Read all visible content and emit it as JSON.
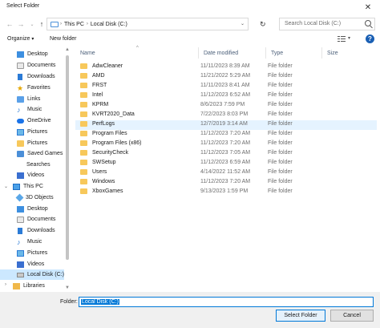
{
  "window": {
    "title": "Select Folder"
  },
  "address": {
    "crumbs": [
      "This PC",
      "Local Disk (C:)"
    ]
  },
  "search": {
    "placeholder": "Search Local Disk (C:)"
  },
  "toolbar": {
    "organize": "Organize",
    "new_folder": "New folder",
    "help": "?"
  },
  "nav": {
    "items": [
      {
        "label": "Desktop",
        "icon": "desktop-icon"
      },
      {
        "label": "Documents",
        "icon": "documents-icon"
      },
      {
        "label": "Downloads",
        "icon": "downloads-icon"
      },
      {
        "label": "Favorites",
        "icon": "favorites-icon"
      },
      {
        "label": "Links",
        "icon": "links-icon"
      },
      {
        "label": "Music",
        "icon": "music-icon"
      },
      {
        "label": "OneDrive",
        "icon": "onedrive-icon"
      },
      {
        "label": "Pictures",
        "icon": "pictures-icon"
      },
      {
        "label": "Pictures",
        "icon": "pictures-icon"
      },
      {
        "label": "Saved Games",
        "icon": "saved-games-icon"
      },
      {
        "label": "Searches",
        "icon": "searches-icon"
      },
      {
        "label": "Videos",
        "icon": "videos-icon"
      },
      {
        "label": "This PC",
        "icon": "this-pc-icon"
      },
      {
        "label": "3D Objects",
        "icon": "3d-objects-icon"
      },
      {
        "label": "Desktop",
        "icon": "desktop-icon"
      },
      {
        "label": "Documents",
        "icon": "documents-icon"
      },
      {
        "label": "Downloads",
        "icon": "downloads-icon"
      },
      {
        "label": "Music",
        "icon": "music-icon"
      },
      {
        "label": "Pictures",
        "icon": "pictures-icon"
      },
      {
        "label": "Videos",
        "icon": "videos-icon"
      },
      {
        "label": "Local Disk (C:)",
        "icon": "local-disk-icon",
        "selected": true
      },
      {
        "label": "Libraries",
        "icon": "libraries-icon"
      }
    ]
  },
  "columns": {
    "name": "Name",
    "date": "Date modified",
    "type": "Type",
    "size": "Size"
  },
  "rows": [
    {
      "name": "AdwCleaner",
      "date": "11/11/2023 8:39 AM",
      "type": "File folder"
    },
    {
      "name": "AMD",
      "date": "11/21/2022 5:29 AM",
      "type": "File folder"
    },
    {
      "name": "FRST",
      "date": "11/11/2023 8:41 AM",
      "type": "File folder"
    },
    {
      "name": "Intel",
      "date": "11/12/2023 6:52 AM",
      "type": "File folder"
    },
    {
      "name": "KPRM",
      "date": "8/6/2023 7:59 PM",
      "type": "File folder"
    },
    {
      "name": "KVRT2020_Data",
      "date": "7/22/2023 8:03 PM",
      "type": "File folder"
    },
    {
      "name": "PerfLogs",
      "date": "12/7/2019 3:14 AM",
      "type": "File folder"
    },
    {
      "name": "Program Files",
      "date": "11/12/2023 7:20 AM",
      "type": "File folder"
    },
    {
      "name": "Program Files (x86)",
      "date": "11/12/2023 7:20 AM",
      "type": "File folder"
    },
    {
      "name": "SecurityCheck",
      "date": "11/12/2023 7:05 AM",
      "type": "File folder"
    },
    {
      "name": "SWSetup",
      "date": "11/12/2023 6:59 AM",
      "type": "File folder"
    },
    {
      "name": "Users",
      "date": "4/14/2022 11:52 AM",
      "type": "File folder"
    },
    {
      "name": "Windows",
      "date": "11/12/2023 7:20 AM",
      "type": "File folder"
    },
    {
      "name": "XboxGames",
      "date": "9/13/2023 1:59 PM",
      "type": "File folder"
    }
  ],
  "footer": {
    "folder_label": "Folder:",
    "folder_value": "Local Disk (C:)",
    "select_button": "Select Folder",
    "cancel_button": "Cancel"
  }
}
